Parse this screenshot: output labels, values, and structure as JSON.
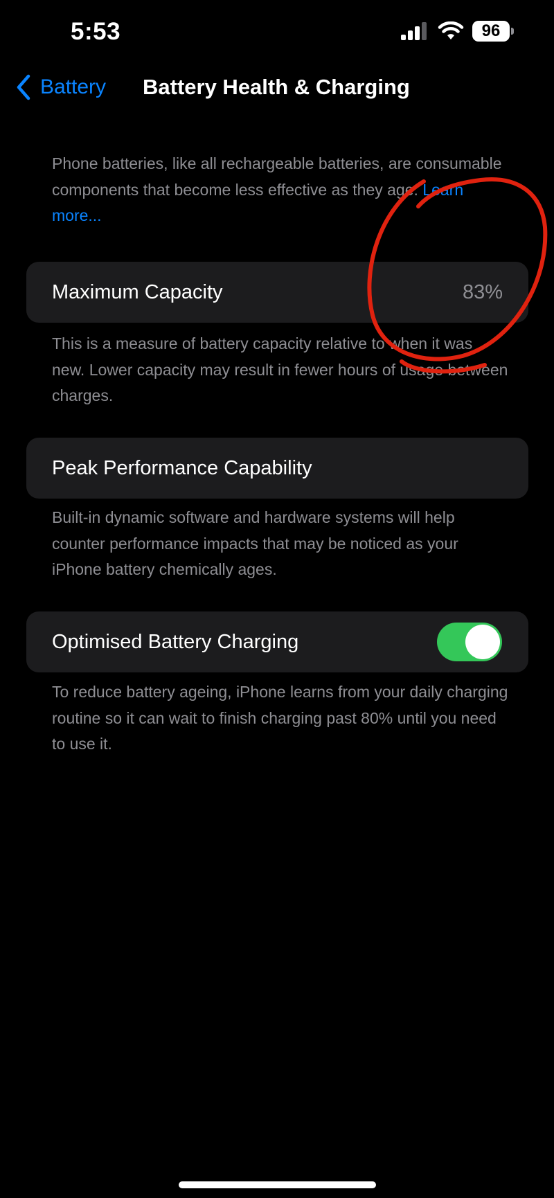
{
  "status_bar": {
    "time": "5:53",
    "battery_level": "96",
    "icons": [
      "cellular-signal-icon",
      "wifi-icon",
      "battery-icon"
    ]
  },
  "nav": {
    "back_label": "Battery",
    "title": "Battery Health & Charging"
  },
  "intro": {
    "text": "Phone batteries, like all rechargeable batteries, are consumable components that become less effective as they age. ",
    "link": "Learn more..."
  },
  "maximum_capacity": {
    "label": "Maximum Capacity",
    "value": "83%",
    "description": "This is a measure of battery capacity relative to when it was new. Lower capacity may result in fewer hours of usage between charges."
  },
  "peak_performance": {
    "label": "Peak Performance Capability",
    "description": "Built-in dynamic software and hardware systems will help counter performance impacts that may be noticed as your iPhone battery chemically ages."
  },
  "optimised_charging": {
    "label": "Optimised Battery Charging",
    "enabled": true,
    "description": "To reduce battery ageing, iPhone learns from your daily charging routine so it can wait to finish charging past 80% until you need to use it."
  },
  "colors": {
    "background": "#000000",
    "card": "#1c1c1e",
    "accent_blue": "#0a84ff",
    "toggle_on": "#34c759",
    "secondary_text": "#8e8e93",
    "annotation_red": "#e0220f"
  }
}
